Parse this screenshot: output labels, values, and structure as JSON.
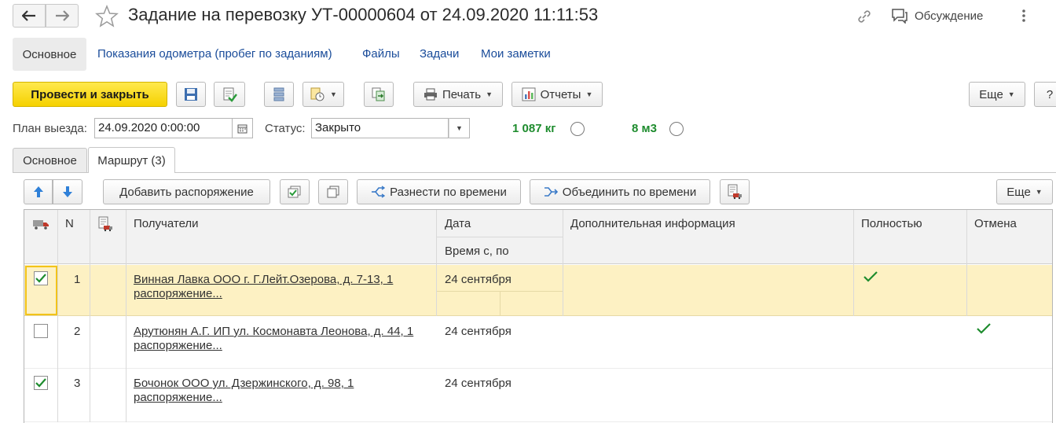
{
  "window": {
    "title": "Задание на перевозку УТ-00000604 от 24.09.2020 11:11:53",
    "discussion_label": "Обсуждение"
  },
  "nav_tabs": [
    {
      "label": "Основное"
    },
    {
      "label": "Показания одометра (пробег по заданиям)"
    },
    {
      "label": "Файлы"
    },
    {
      "label": "Задачи"
    },
    {
      "label": "Мои заметки"
    }
  ],
  "toolbar": {
    "post_close_label": "Провести и закрыть",
    "print_label": "Печать",
    "reports_label": "Отчеты",
    "more_label": "Еще",
    "help_label": "?"
  },
  "form": {
    "plan_label": "План выезда:",
    "plan_value": "24.09.2020  0:00:00",
    "status_label": "Статус:",
    "status_value": "Закрыто",
    "weight_value": "1 087 кг",
    "volume_value": "8 м3"
  },
  "inner_tabs": [
    {
      "label": "Основное"
    },
    {
      "label": "Маршрут (3)"
    }
  ],
  "route_toolbar": {
    "add_order_label": "Добавить распоряжение",
    "distribute_label": "Разнести по времени",
    "combine_label": "Объединить по времени",
    "more_label": "Еще"
  },
  "table": {
    "columns": {
      "n": "N",
      "recipients": "Получатели",
      "date": "Дата",
      "time": "Время с, по",
      "extra": "Дополнительная информация",
      "full": "Полностью",
      "cancel": "Отмена"
    },
    "rows": [
      {
        "checked": true,
        "n": "1",
        "recipient_line1": "Винная Лавка ООО г. Г.Лейт.Озерова, д. 7-13, 1",
        "recipient_line2": "распоряжение...",
        "date": "24 сентября",
        "full": true,
        "cancel": false,
        "selected": true
      },
      {
        "checked": false,
        "n": "2",
        "recipient_line1": "Арутюнян А.Г. ИП ул. Космонавта Леонова, д. 44, 1",
        "recipient_line2": "распоряжение...",
        "date": "24 сентября",
        "full": false,
        "cancel": true,
        "selected": false
      },
      {
        "checked": true,
        "n": "3",
        "recipient_line1": "Бочонок ООО ул. Дзержинского, д. 98, 1",
        "recipient_line2": "распоряжение...",
        "date": "24 сентября",
        "full": false,
        "cancel": false,
        "selected": false
      }
    ]
  },
  "colors": {
    "accent_yellow": "#f5d100",
    "link_blue": "#1a4c9a",
    "green": "#1e8c2e",
    "selected_row": "#fdf1c3"
  }
}
